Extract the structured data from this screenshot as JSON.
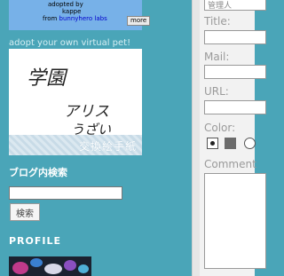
{
  "pet_widget": {
    "adopted_by": "adopted by",
    "author": "kappe",
    "from_prefix": "from",
    "from_link": "bunnyhero labs",
    "more_button": "more"
  },
  "adopt_link": "adopt your own virtual pet!",
  "card": {
    "handwriting_line1": "学園",
    "handwriting_line2": "アリス",
    "handwriting_line3": "うざい",
    "caption": "交換絵手紙"
  },
  "search": {
    "heading": "ブログ内検索",
    "input_value": "",
    "button_label": "検索"
  },
  "profile": {
    "heading": "PROFILE"
  },
  "comment_form": {
    "name_value": "管理人",
    "title_label": "Title:",
    "mail_label": "Mail:",
    "url_label": "URL:",
    "color_label": "Color:",
    "color_selected": "#6b6b6b",
    "comment_label": "Comment"
  }
}
